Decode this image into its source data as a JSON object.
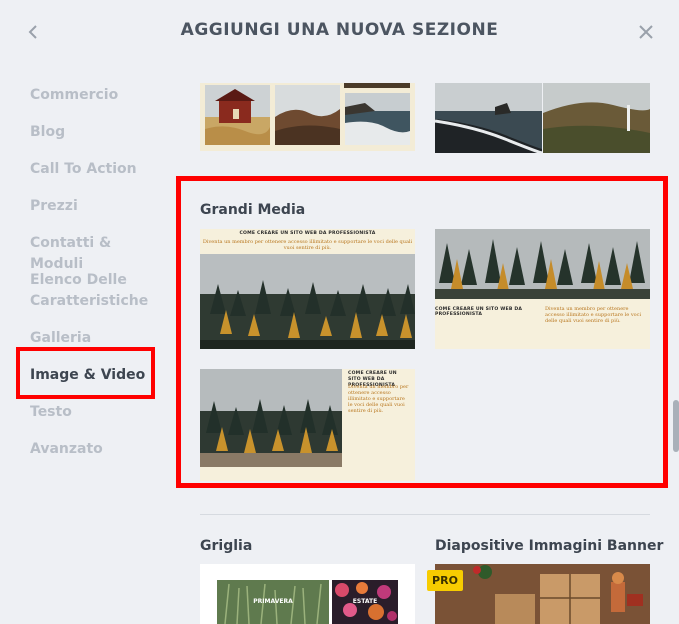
{
  "header": {
    "title": "AGGIUNGI UNA NUOVA SEZIONE",
    "back_icon": "chevron-left-icon",
    "close_icon": "close-icon"
  },
  "sidebar": {
    "items": [
      {
        "label": "Commercio"
      },
      {
        "label": "Blog"
      },
      {
        "label": "Call To Action"
      },
      {
        "label": "Prezzi"
      },
      {
        "label": "Contatti & Moduli"
      },
      {
        "label": "Elenco Delle Caratteristiche"
      },
      {
        "label": "Galleria"
      },
      {
        "label": "Image & Video",
        "active": true
      },
      {
        "label": "Testo"
      },
      {
        "label": "Avanzato"
      }
    ]
  },
  "sections": {
    "grandi_media": {
      "title": "Grandi Media",
      "tile1": {
        "headline": "COME CREARE UN SITO WEB DA PROFESSIONISTA",
        "body": "Diventa un membro per ottenere accesso illimitato e supportare le voci delle quali vuoi sentire di più."
      },
      "tile2": {
        "headline": "COME CREARE UN SITO WEB DA PROFESSIONISTA",
        "body": "Diventa un membro per ottenere accesso illimitato e supportare le voci delle quali vuoi sentire di più."
      },
      "tile3": {
        "headline": "COME CREARE UN SITO WEB DA PROFESSIONISTA",
        "body": "Diventa un membro per ottenere accesso illimitato e supportare le voci delle quali vuoi sentire di più."
      }
    },
    "griglia": {
      "title": "Griglia",
      "labels": [
        "PRIMAVERA",
        "ESTATE"
      ]
    },
    "diapositive": {
      "title": "Diapositive Immagini Banner",
      "badge": "PRO"
    }
  },
  "colors": {
    "highlight": "#ff0000",
    "cream": "#f6f0dc",
    "accent_text": "#b8761e",
    "pro_badge": "#f7cc00"
  }
}
